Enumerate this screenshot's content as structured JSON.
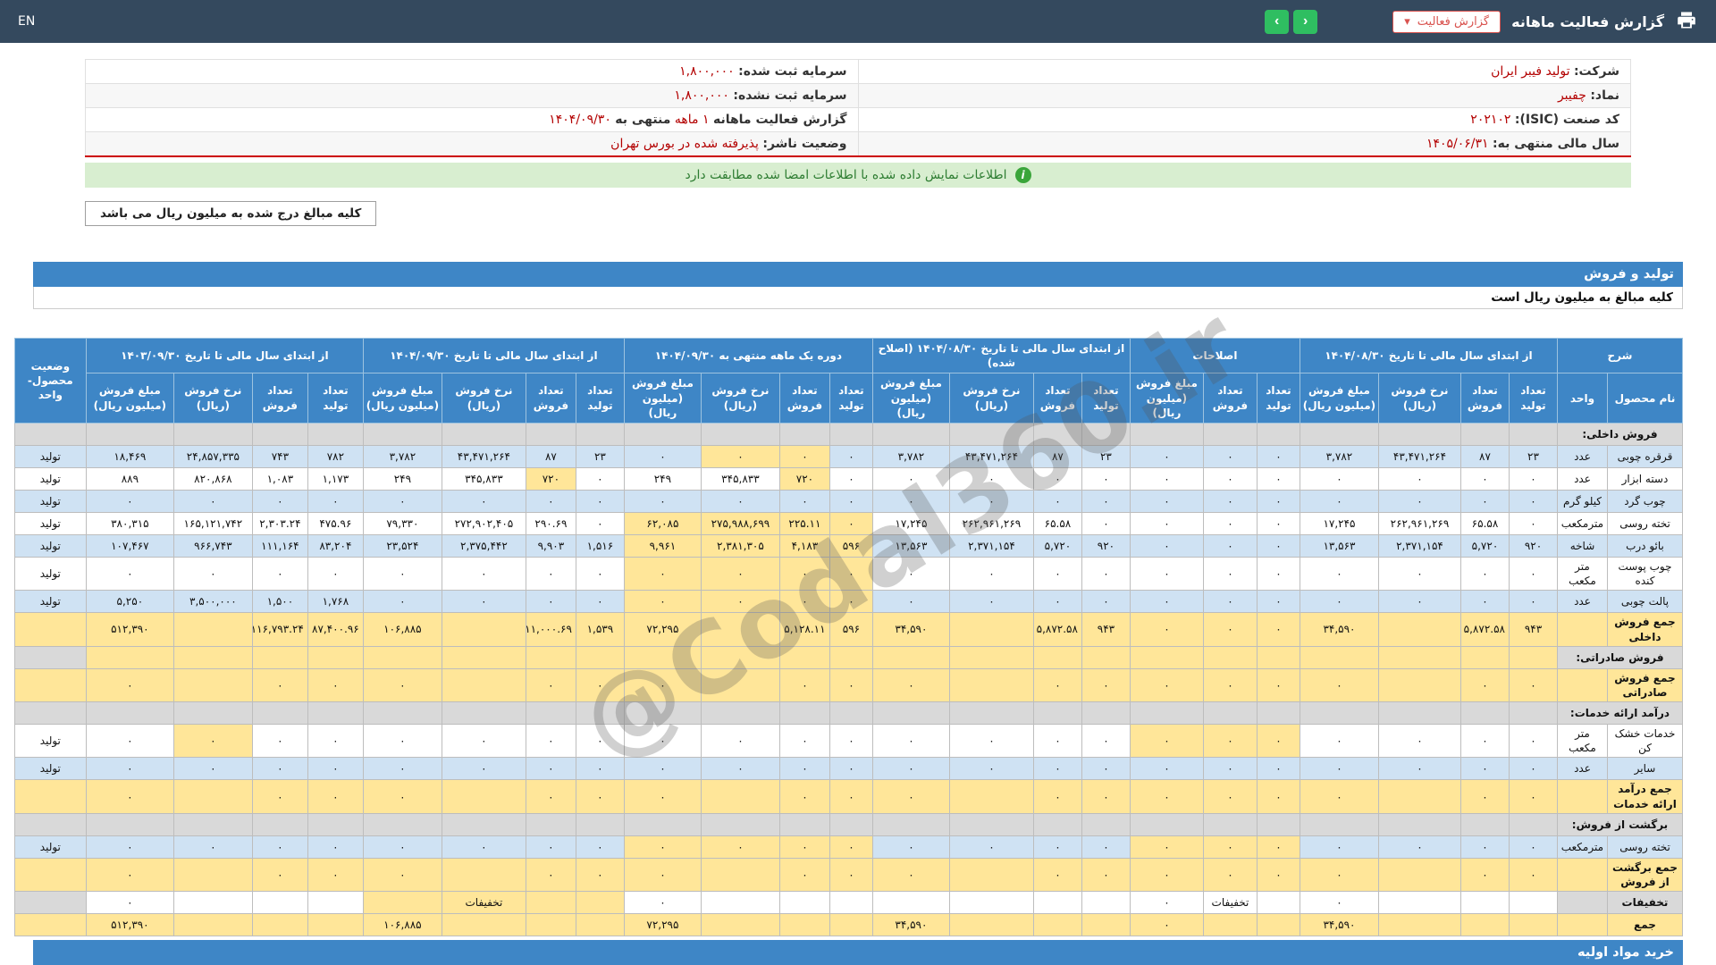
{
  "topbar": {
    "lang_toggle": "EN",
    "title": "گزارش فعالیت ماهانه",
    "dropdown_label": "گزارش فعالیت",
    "caret_glyph": "▾",
    "nav_forward_glyph": "›",
    "nav_back_glyph": "‹",
    "printer_icon": "printer-icon",
    "colors": {
      "navbar_bg": "#34495e",
      "nav_button_green": "#2fbe61",
      "dropdown_red": "#d9534f"
    }
  },
  "info": {
    "rows": [
      {
        "right": {
          "label": "شرکت:",
          "value": "تولید فیبر ایران"
        },
        "left": {
          "label": "سرمایه ثبت شده:",
          "value": "۱,۸۰۰,۰۰۰"
        }
      },
      {
        "right": {
          "label": "نماد:",
          "value": "چفیبر"
        },
        "left": {
          "label": "سرمایه ثبت نشده:",
          "value": "۱,۸۰۰,۰۰۰"
        }
      },
      {
        "right": {
          "label": "کد صنعت (ISIC):",
          "value": "۲۰۲۱۰۲"
        },
        "left": {
          "label": "گزارش فعالیت ماهانه",
          "value": "۱ ماهه",
          "label2": "منتهی به",
          "value2": "۱۴۰۴/۰۹/۳۰"
        }
      },
      {
        "right": {
          "label": "سال مالی منتهی به:",
          "value": "۱۴۰۵/۰۶/۳۱"
        },
        "left": {
          "label": "وضعیت ناشر:",
          "value": "پذیرفته شده در بورس تهران"
        }
      }
    ],
    "signed_notice": "اطلاعات نمایش داده شده با اطلاعات امضا شده مطابقت دارد",
    "info_icon_glyph": "i",
    "amount_note": "کلیه مبالغ درج شده به میلیون ریال می باشد"
  },
  "production": {
    "section_title": "تولید و فروش",
    "unit_note": "کلیه مبالغ به میلیون ریال است",
    "header": {
      "desc": "شرح",
      "product": "نام محصول",
      "unit": "واحد",
      "status": "وضعیت محصول-واحد",
      "groups": [
        {
          "label": "از ابتدای سال مالی تا تاریخ ۱۴۰۴/۰۸/۳۰",
          "cols": [
            "تعداد تولید",
            "تعداد فروش",
            "نرخ فروش (ریال)",
            "مبلغ فروش (میلیون ریال)"
          ]
        },
        {
          "label": "اصلاحات",
          "cols": [
            "تعداد تولید",
            "تعداد فروش",
            "مبلغ فروش (میلیون ریال)"
          ]
        },
        {
          "label": "از ابتدای سال مالی تا تاریخ ۱۴۰۴/۰۸/۳۰ (اصلاح شده)",
          "cols": [
            "تعداد تولید",
            "تعداد فروش",
            "نرخ فروش (ریال)",
            "مبلغ فروش (میلیون ریال)"
          ]
        },
        {
          "label": "دوره یک ماهه منتهی به ۱۴۰۴/۰۹/۳۰",
          "cols": [
            "تعداد تولید",
            "تعداد فروش",
            "نرخ فروش (ریال)",
            "مبلغ فروش (میلیون ریال)"
          ]
        },
        {
          "label": "از ابتدای سال مالی تا تاریخ ۱۴۰۴/۰۹/۳۰",
          "cols": [
            "تعداد تولید",
            "تعداد فروش",
            "نرخ فروش (ریال)",
            "مبلغ فروش (میلیون ریال)"
          ]
        },
        {
          "label": "از ابتدای سال مالی تا تاریخ ۱۴۰۳/۰۹/۳۰",
          "cols": [
            "تعداد تولید",
            "تعداد فروش",
            "نرخ فروش (ریال)",
            "مبلغ فروش (میلیون ریال)"
          ]
        }
      ]
    },
    "rows": [
      {
        "type": "section",
        "label": "فروش داخلی:",
        "base": "gray"
      },
      {
        "type": "data",
        "name": "قرقره چوبی",
        "unit": "عدد",
        "status": "تولید",
        "base": "blue",
        "c": [
          "۲۳",
          "۸۷",
          "۴۳,۴۷۱,۲۶۴",
          "۳,۷۸۲",
          "۰",
          "۰",
          "۰",
          "۲۳",
          "۸۷",
          "۴۳,۴۷۱,۲۶۴",
          "۳,۷۸۲",
          "۰",
          "۰",
          "۰",
          "۰",
          "۲۳",
          "۸۷",
          "۴۳,۴۷۱,۲۶۴",
          "۳,۷۸۲",
          "۷۸۲",
          "۷۴۳",
          "۲۴,۸۵۷,۳۳۵",
          "۱۸,۴۶۹"
        ],
        "hl": [
          12,
          13
        ]
      },
      {
        "type": "data",
        "name": "دسته ابزار",
        "unit": "عدد",
        "status": "تولید",
        "base": "white",
        "c": [
          "۰",
          "۰",
          "۰",
          "۰",
          "۰",
          "۰",
          "۰",
          "۰",
          "۰",
          "۰",
          "۰",
          "۰",
          "۷۲۰",
          "۳۴۵,۸۳۳",
          "۲۴۹",
          "۰",
          "۷۲۰",
          "۳۴۵,۸۳۳",
          "۲۴۹",
          "۱,۱۷۳",
          "۱,۰۸۳",
          "۸۲۰,۸۶۸",
          "۸۸۹"
        ],
        "hl": [
          12,
          16
        ]
      },
      {
        "type": "data",
        "name": "چوب گرد",
        "unit": "کیلو گرم",
        "status": "تولید",
        "base": "blue",
        "c": [
          "۰",
          "۰",
          "۰",
          "۰",
          "۰",
          "۰",
          "۰",
          "۰",
          "۰",
          "۰",
          "۰",
          "۰",
          "۰",
          "۰",
          "۰",
          "۰",
          "۰",
          "۰",
          "۰",
          "۰",
          "۰",
          "۰",
          "۰"
        ],
        "hl": []
      },
      {
        "type": "data",
        "name": "تخته روسی",
        "unit": "مترمکعب",
        "status": "تولید",
        "base": "white",
        "c": [
          "۰",
          "۶۵.۵۸",
          "۲۶۲,۹۶۱,۲۶۹",
          "۱۷,۲۴۵",
          "۰",
          "۰",
          "۰",
          "۰",
          "۶۵.۵۸",
          "۲۶۲,۹۶۱,۲۶۹",
          "۱۷,۲۴۵",
          "۰",
          "۲۲۵.۱۱",
          "۲۷۵,۹۸۸,۶۹۹",
          "۶۲,۰۸۵",
          "۰",
          "۲۹۰.۶۹",
          "۲۷۲,۹۰۲,۴۰۵",
          "۷۹,۳۳۰",
          "۴۷۵.۹۶",
          "۲,۳۰۳.۲۴",
          "۱۶۵,۱۲۱,۷۴۲",
          "۳۸۰,۳۱۵"
        ],
        "hl": [
          11,
          12,
          13,
          14
        ]
      },
      {
        "type": "data",
        "name": "بائو درب",
        "unit": "شاخه",
        "status": "تولید",
        "base": "blue",
        "c": [
          "۹۲۰",
          "۵,۷۲۰",
          "۲,۳۷۱,۱۵۴",
          "۱۳,۵۶۳",
          "۰",
          "۰",
          "۰",
          "۹۲۰",
          "۵,۷۲۰",
          "۲,۳۷۱,۱۵۴",
          "۱۳,۵۶۳",
          "۵۹۶",
          "۴,۱۸۳",
          "۲,۳۸۱,۳۰۵",
          "۹,۹۶۱",
          "۱,۵۱۶",
          "۹,۹۰۳",
          "۲,۳۷۵,۴۴۲",
          "۲۳,۵۲۴",
          "۸۳,۲۰۴",
          "۱۱۱,۱۶۴",
          "۹۶۶,۷۴۳",
          "۱۰۷,۴۶۷"
        ],
        "hl": [
          11,
          12,
          13,
          14
        ]
      },
      {
        "type": "data",
        "name": "چوب پوست کنده",
        "unit": "متر مکعب",
        "status": "تولید",
        "base": "white",
        "c": [
          "۰",
          "۰",
          "۰",
          "۰",
          "۰",
          "۰",
          "۰",
          "۰",
          "۰",
          "۰",
          "۰",
          "۰",
          "۰",
          "۰",
          "۰",
          "۰",
          "۰",
          "۰",
          "۰",
          "۰",
          "۰",
          "۰",
          "۰"
        ],
        "hl": [
          11,
          12,
          13,
          14
        ]
      },
      {
        "type": "data",
        "name": "پالت چوبی",
        "unit": "عدد",
        "status": "تولید",
        "base": "blue",
        "c": [
          "۰",
          "۰",
          "۰",
          "۰",
          "۰",
          "۰",
          "۰",
          "۰",
          "۰",
          "۰",
          "۰",
          "۰",
          "۰",
          "۰",
          "۰",
          "۰",
          "۰",
          "۰",
          "۰",
          "۱,۷۶۸",
          "۱,۵۰۰",
          "۳,۵۰۰,۰۰۰",
          "۵,۲۵۰"
        ],
        "hl": [
          11,
          12,
          13,
          14
        ]
      },
      {
        "type": "total",
        "name": "جمع فروش داخلی",
        "c": [
          "۹۴۳",
          "۵,۸۷۲.۵۸",
          "",
          "۳۴,۵۹۰",
          "۰",
          "۰",
          "۰",
          "۹۴۳",
          "۵,۸۷۲.۵۸",
          "",
          "۳۴,۵۹۰",
          "۵۹۶",
          "۵,۱۲۸.۱۱",
          "",
          "۷۲,۲۹۵",
          "۱,۵۳۹",
          "۱۱,۰۰۰.۶۹",
          "",
          "۱۰۶,۸۸۵",
          "۸۷,۴۰۰.۹۶",
          "۱۱۶,۷۹۳.۲۴",
          "",
          "۵۱۲,۳۹۰"
        ]
      },
      {
        "type": "section",
        "label": "فروش صادراتی:",
        "base": "wheat"
      },
      {
        "type": "total",
        "name": "جمع فروش صادراتی",
        "c": [
          "۰",
          "۰",
          "",
          "۰",
          "۰",
          "۰",
          "۰",
          "۰",
          "۰",
          "",
          "۰",
          "۰",
          "۰",
          "",
          "۰",
          "۰",
          "۰",
          "",
          "۰",
          "۰",
          "۰",
          "",
          "۰"
        ]
      },
      {
        "type": "section",
        "label": "درآمد ارائه خدمات:",
        "base": "gray"
      },
      {
        "type": "data",
        "name": "خدمات خشک کن",
        "unit": "متر مکعب",
        "status": "تولید",
        "base": "white",
        "c": [
          "۰",
          "۰",
          "۰",
          "۰",
          "۰",
          "۰",
          "۰",
          "۰",
          "۰",
          "۰",
          "۰",
          "۰",
          "۰",
          "۰",
          "۰",
          "۰",
          "۰",
          "۰",
          "۰",
          "۰",
          "۰",
          "۰",
          "۰"
        ],
        "hl": [
          4,
          5,
          6,
          21
        ]
      },
      {
        "type": "data",
        "name": "سایر",
        "unit": "عدد",
        "status": "تولید",
        "base": "blue",
        "c": [
          "۰",
          "۰",
          "۰",
          "۰",
          "۰",
          "۰",
          "۰",
          "۰",
          "۰",
          "۰",
          "۰",
          "۰",
          "۰",
          "۰",
          "۰",
          "۰",
          "۰",
          "۰",
          "۰",
          "۰",
          "۰",
          "۰",
          "۰"
        ],
        "hl": []
      },
      {
        "type": "total",
        "name": "جمع درآمد ارائه خدمات",
        "c": [
          "۰",
          "۰",
          "",
          "۰",
          "۰",
          "۰",
          "۰",
          "۰",
          "۰",
          "",
          "۰",
          "۰",
          "۰",
          "",
          "۰",
          "۰",
          "۰",
          "",
          "۰",
          "۰",
          "۰",
          "",
          "۰"
        ]
      },
      {
        "type": "section",
        "label": "برگشت از فروش:",
        "base": "gray"
      },
      {
        "type": "data",
        "name": "تخته روسی",
        "unit": "مترمکعب",
        "status": "تولید",
        "base": "blue",
        "c": [
          "۰",
          "۰",
          "۰",
          "۰",
          "۰",
          "۰",
          "۰",
          "۰",
          "۰",
          "۰",
          "۰",
          "۰",
          "۰",
          "۰",
          "۰",
          "۰",
          "۰",
          "۰",
          "۰",
          "۰",
          "۰",
          "۰",
          "۰"
        ],
        "hl": [
          4,
          5,
          6,
          11,
          12,
          13,
          14
        ]
      },
      {
        "type": "total",
        "name": "جمع برگشت از فروش",
        "c": [
          "۰",
          "۰",
          "",
          "۰",
          "۰",
          "۰",
          "۰",
          "۰",
          "۰",
          "",
          "۰",
          "۰",
          "۰",
          "",
          "۰",
          "۰",
          "۰",
          "",
          "۰",
          "۰",
          "۰",
          "",
          "۰"
        ]
      },
      {
        "type": "discount",
        "name": "تخفیفات",
        "unit": "",
        "status": "",
        "base": "white",
        "c": [
          "",
          "",
          "",
          "۰",
          "",
          "تخفیفات",
          "۰",
          "",
          "",
          "",
          "",
          "",
          "",
          "",
          "۰",
          "",
          "",
          "تخفیفات",
          "",
          "",
          "",
          "",
          "۰"
        ],
        "hl": [
          15,
          16,
          17,
          18
        ]
      },
      {
        "type": "total",
        "name": "جمع",
        "c": [
          "",
          "",
          "",
          "۳۴,۵۹۰",
          "",
          "",
          "۰",
          "",
          "",
          "",
          "۳۴,۵۹۰",
          "",
          "",
          "",
          "۷۲,۲۹۵",
          "",
          "",
          "",
          "۱۰۶,۸۸۵",
          "",
          "",
          "",
          "۵۱۲,۳۹۰"
        ]
      }
    ]
  },
  "next_section": {
    "title": "خرید مواد اولیه"
  },
  "watermark": "@Codal360.ir",
  "palette": {
    "table_header_blue": "#3e86c6",
    "row_light_blue": "#cfe2f3",
    "highlight_wheat": "#ffe699",
    "row_gray": "#d9d9d9",
    "value_red": "#b30000",
    "notice_green_bg": "#d8eed0",
    "notice_green_text": "#2e7d32",
    "divider_red": "#cc0000"
  }
}
